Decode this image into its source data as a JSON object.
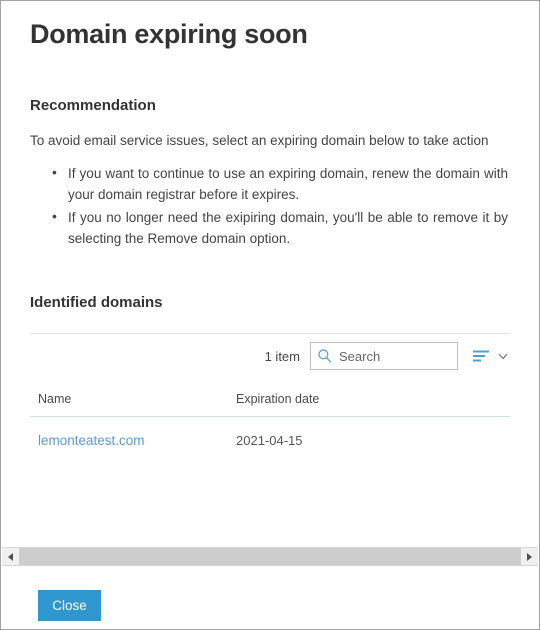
{
  "dialog": {
    "title": "Domain expiring soon"
  },
  "recommendation": {
    "heading": "Recommendation",
    "intro": "To avoid email service issues, select an expiring domain below to take action",
    "bullets": [
      "If you want to continue to use an expiring domain, renew the domain with your domain registrar before it expires.",
      "If you no longer need the exipiring domain, you'll be able to remove it by selecting the Remove domain option."
    ]
  },
  "identified_domains": {
    "heading": "Identified domains",
    "toolbar": {
      "item_count": "1 item",
      "search_placeholder": "Search",
      "search_value": "",
      "search_icon": "search-icon",
      "filter_icon": "filter-list-icon",
      "chevron_icon": "chevron-down-icon"
    },
    "table": {
      "columns": [
        "Name",
        "Expiration date"
      ],
      "rows": [
        {
          "name": "lemonteatest.com",
          "expiration_date": "2021-04-15"
        }
      ]
    }
  },
  "scrollbar": {
    "left_arrow_icon": "arrow-left-icon",
    "right_arrow_icon": "arrow-right-icon"
  },
  "footer": {
    "close_label": "Close"
  },
  "colors": {
    "accent_blue": "#2f97ce",
    "link_blue": "#5b9bd5",
    "text_dark": "#333333",
    "text_body": "#444444",
    "divider": "#e1e1e1",
    "table_rule": "#cfe0eb",
    "scroll_thumb": "#cdcdcd",
    "window_border": "#a3a3a3"
  }
}
